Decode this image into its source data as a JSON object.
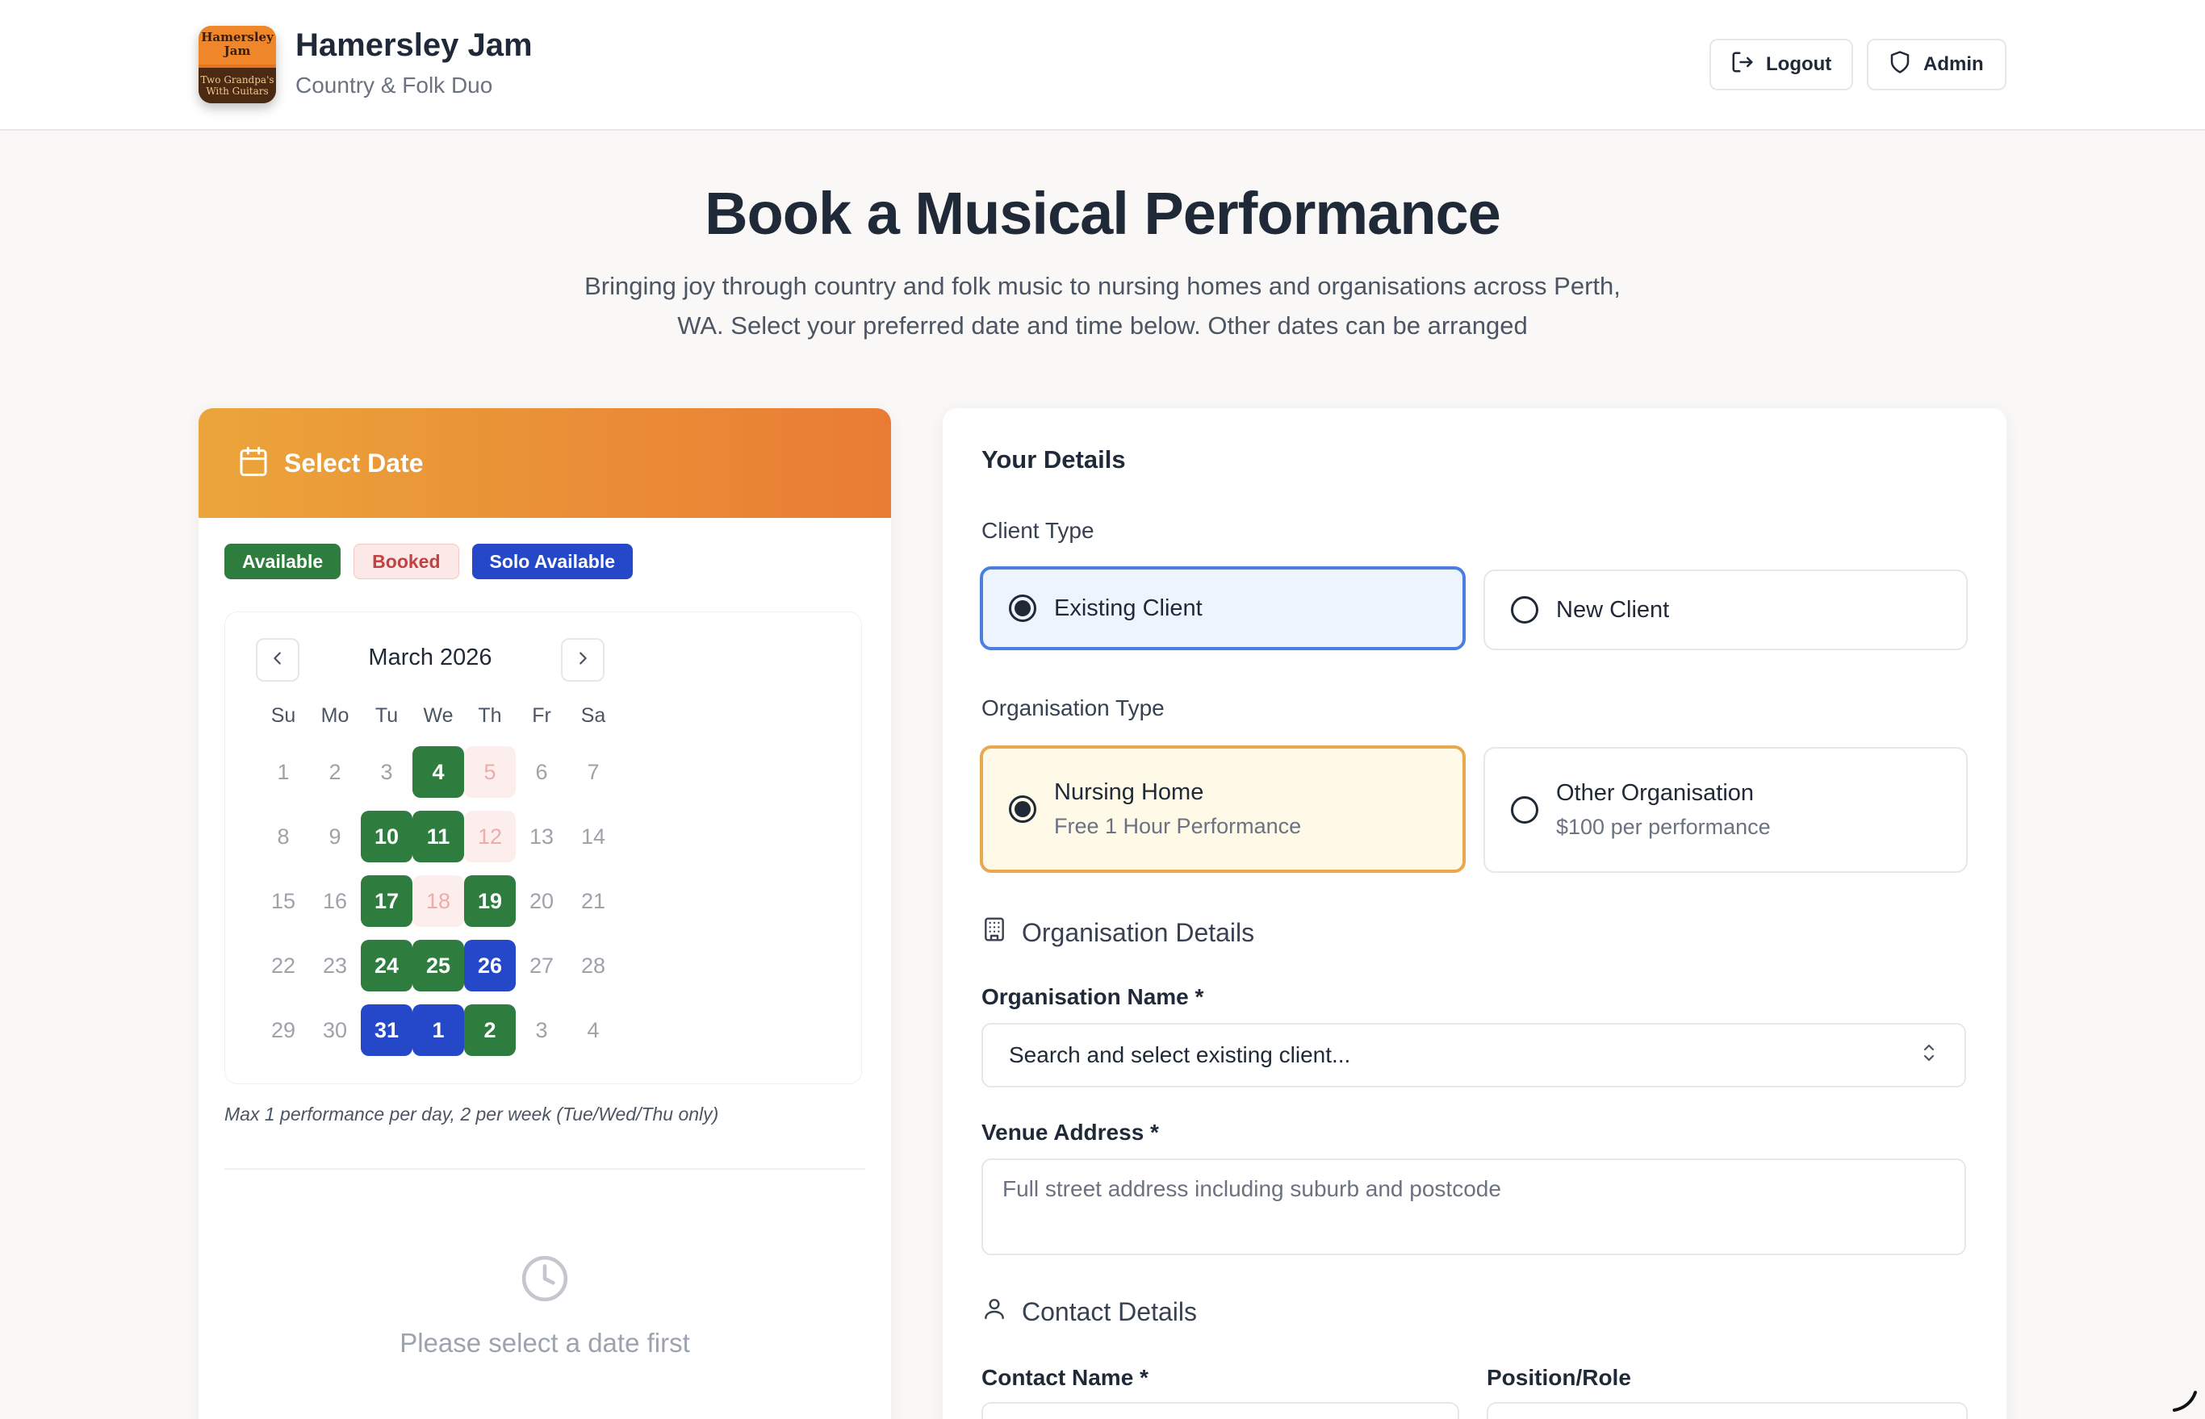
{
  "header": {
    "logo": {
      "top_text": "Hamersley Jam",
      "bottom_text": "Two Grandpa's With Guitars"
    },
    "brand_name": "Hamersley Jam",
    "brand_tagline": "Country & Folk Duo",
    "buttons": {
      "logout": "Logout",
      "admin": "Admin"
    }
  },
  "hero": {
    "title": "Book a Musical Performance",
    "subtitle": "Bringing joy through country and folk music to nursing homes and organisations across Perth, WA. Select your preferred date and time below. Other dates can be arranged"
  },
  "calendar": {
    "header_title": "Select Date",
    "legend": {
      "available": "Available",
      "booked": "Booked",
      "solo": "Solo Available"
    },
    "month": "March 2026",
    "days_of_week": [
      "Su",
      "Mo",
      "Tu",
      "We",
      "Th",
      "Fr",
      "Sa"
    ],
    "weeks": [
      [
        {
          "d": "1",
          "s": "none"
        },
        {
          "d": "2",
          "s": "none"
        },
        {
          "d": "3",
          "s": "none"
        },
        {
          "d": "4",
          "s": "available"
        },
        {
          "d": "5",
          "s": "booked"
        },
        {
          "d": "6",
          "s": "none"
        },
        {
          "d": "7",
          "s": "none"
        }
      ],
      [
        {
          "d": "8",
          "s": "none"
        },
        {
          "d": "9",
          "s": "none"
        },
        {
          "d": "10",
          "s": "available"
        },
        {
          "d": "11",
          "s": "available"
        },
        {
          "d": "12",
          "s": "booked"
        },
        {
          "d": "13",
          "s": "none"
        },
        {
          "d": "14",
          "s": "none"
        }
      ],
      [
        {
          "d": "15",
          "s": "none"
        },
        {
          "d": "16",
          "s": "none"
        },
        {
          "d": "17",
          "s": "available"
        },
        {
          "d": "18",
          "s": "booked"
        },
        {
          "d": "19",
          "s": "available"
        },
        {
          "d": "20",
          "s": "none"
        },
        {
          "d": "21",
          "s": "none"
        }
      ],
      [
        {
          "d": "22",
          "s": "none"
        },
        {
          "d": "23",
          "s": "none"
        },
        {
          "d": "24",
          "s": "available"
        },
        {
          "d": "25",
          "s": "available"
        },
        {
          "d": "26",
          "s": "solo"
        },
        {
          "d": "27",
          "s": "none"
        },
        {
          "d": "28",
          "s": "none"
        }
      ],
      [
        {
          "d": "29",
          "s": "none"
        },
        {
          "d": "30",
          "s": "none"
        },
        {
          "d": "31",
          "s": "solo"
        },
        {
          "d": "1",
          "s": "solo"
        },
        {
          "d": "2",
          "s": "available"
        },
        {
          "d": "3",
          "s": "none"
        },
        {
          "d": "4",
          "s": "none"
        }
      ]
    ],
    "note": "Max 1 performance per day, 2 per week (Tue/Wed/Thu only)",
    "empty_message": "Please select a date first"
  },
  "details": {
    "title": "Your Details",
    "client_type_label": "Client Type",
    "client_options": {
      "existing": "Existing Client",
      "new": "New Client"
    },
    "org_type_label": "Organisation Type",
    "org_options": {
      "nursing": {
        "label": "Nursing Home",
        "sub": "Free 1 Hour Performance"
      },
      "other": {
        "label": "Other Organisation",
        "sub": "$100 per performance"
      }
    },
    "org_details_heading": "Organisation Details",
    "org_name_label": "Organisation Name *",
    "org_name_value": "Search and select existing client...",
    "venue_label": "Venue Address *",
    "venue_placeholder": "Full street address including suburb and postcode",
    "contact_heading": "Contact Details",
    "contact_name_label": "Contact Name *",
    "position_label": "Position/Role"
  },
  "colors": {
    "available": "#2e7d3e",
    "booked": "#fdeeee",
    "solo": "#2548c9",
    "header_gradient_start": "#eba53a",
    "header_gradient_end": "#e97c34"
  }
}
